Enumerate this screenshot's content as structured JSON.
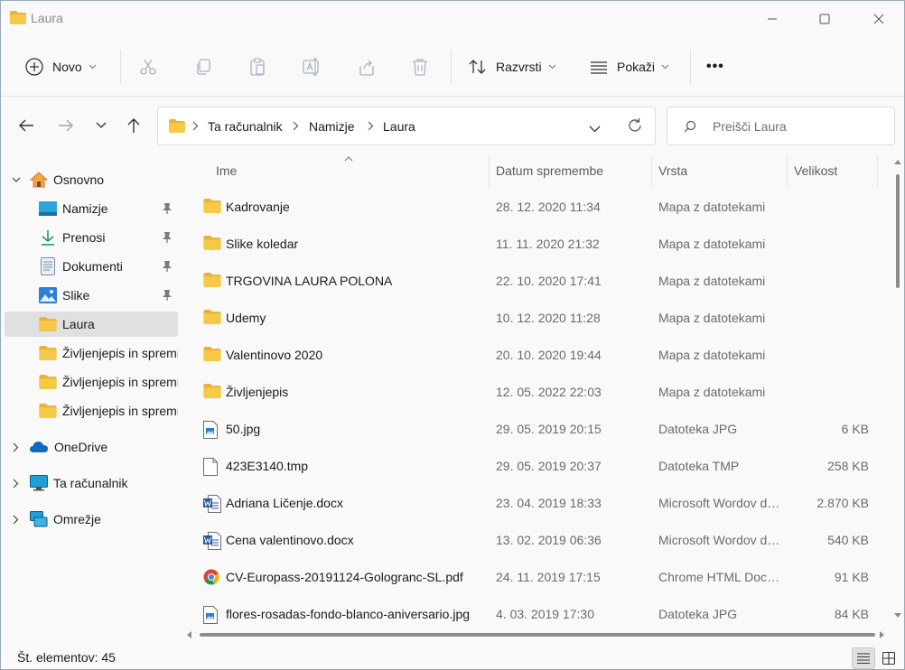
{
  "window": {
    "title": "Laura"
  },
  "toolbar": {
    "new_label": "Novo",
    "sort_label": "Razvrsti",
    "view_label": "Pokaži",
    "more_label": "•••"
  },
  "address": {
    "crumbs": [
      "Ta računalnik",
      "Namizje",
      "Laura"
    ]
  },
  "search": {
    "placeholder": "Preišči Laura"
  },
  "sidebar": {
    "items": [
      {
        "label": "Osnovno",
        "icon": "home-icon"
      },
      {
        "label": "Namizje",
        "icon": "desktop-icon"
      },
      {
        "label": "Prenosi",
        "icon": "download-icon"
      },
      {
        "label": "Dokumenti",
        "icon": "documents-icon"
      },
      {
        "label": "Slike",
        "icon": "pictures-icon"
      },
      {
        "label": "Laura",
        "icon": "folder-icon"
      },
      {
        "label": "Življenjepis in spremno pismo",
        "icon": "folder-icon"
      },
      {
        "label": "Življenjepis in spremno pismo",
        "icon": "folder-icon"
      },
      {
        "label": "Življenjepis in spremno pismo",
        "icon": "folder-icon"
      },
      {
        "label": "OneDrive",
        "icon": "cloud-icon"
      },
      {
        "label": "Ta računalnik",
        "icon": "computer-icon"
      },
      {
        "label": "Omrežje",
        "icon": "network-icon"
      }
    ]
  },
  "columns": {
    "name": "Ime",
    "date": "Datum spremembe",
    "type": "Vrsta",
    "size": "Velikost"
  },
  "files": [
    {
      "name": "Kadrovanje",
      "date": "28. 12. 2020 11:34",
      "type": "Mapa z datotekami",
      "size": "",
      "icon": "folder-icon"
    },
    {
      "name": "Slike koledar",
      "date": "11. 11. 2020 21:32",
      "type": "Mapa z datotekami",
      "size": "",
      "icon": "folder-icon"
    },
    {
      "name": "TRGOVINA LAURA POLONA",
      "date": "22. 10. 2020 17:41",
      "type": "Mapa z datotekami",
      "size": "",
      "icon": "folder-icon"
    },
    {
      "name": "Udemy",
      "date": "10. 12. 2020 11:28",
      "type": "Mapa z datotekami",
      "size": "",
      "icon": "folder-icon"
    },
    {
      "name": "Valentinovo 2020",
      "date": "20. 10. 2020 19:44",
      "type": "Mapa z datotekami",
      "size": "",
      "icon": "folder-icon"
    },
    {
      "name": "Življenjepis",
      "date": "12. 05. 2022 22:03",
      "type": "Mapa z datotekami",
      "size": "",
      "icon": "folder-icon"
    },
    {
      "name": "50.jpg",
      "date": "29. 05. 2019 20:15",
      "type": "Datoteka JPG",
      "size": "6 KB",
      "icon": "image-file-icon"
    },
    {
      "name": "423E3140.tmp",
      "date": "29. 05. 2019 20:37",
      "type": "Datoteka TMP",
      "size": "258 KB",
      "icon": "blank-file-icon"
    },
    {
      "name": "Adriana Ličenje.docx",
      "date": "23. 04. 2019 18:33",
      "type": "Microsoft Wordov dokument",
      "size": "2.870 KB",
      "icon": "word-file-icon"
    },
    {
      "name": "Cena valentinovo.docx",
      "date": "13. 02. 2019 06:36",
      "type": "Microsoft Wordov dokument",
      "size": "540 KB",
      "icon": "word-file-icon"
    },
    {
      "name": "CV-Europass-20191124-Gologranc-SL.pdf",
      "date": "24. 11. 2019 17:15",
      "type": "Chrome HTML Document",
      "size": "91 KB",
      "icon": "chrome-file-icon"
    },
    {
      "name": "flores-rosadas-fondo-blanco-aniversario.jpg",
      "date": "4. 03. 2019 17:30",
      "type": "Datoteka JPG",
      "size": "84 KB",
      "icon": "image-file-icon"
    }
  ],
  "status": {
    "count_text": "Št. elementov: 45"
  },
  "colors": {
    "folder": "#f4c542",
    "accent": "#0067c0",
    "selected": "#e0e0e0"
  }
}
